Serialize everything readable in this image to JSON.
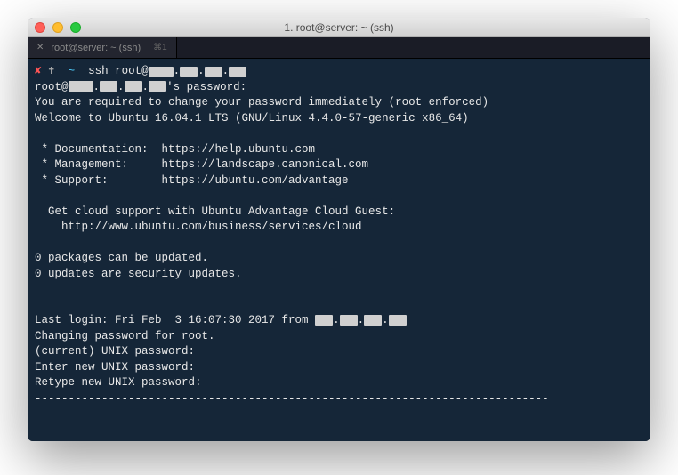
{
  "window": {
    "title": "1. root@server: ~ (ssh)"
  },
  "tab": {
    "label": "root@server: ~ (ssh)",
    "shortcut": "⌘1"
  },
  "prompt": {
    "x": "✘",
    "cross": "✝",
    "tilde": "~",
    "command": "ssh root@"
  },
  "lines": {
    "l1a": "root@",
    "l1b": "'s password:",
    "l2": "You are required to change your password immediately (root enforced)",
    "l3": "Welcome to Ubuntu 16.04.1 LTS (GNU/Linux 4.4.0-57-generic x86_64)",
    "l4": " * Documentation:  https://help.ubuntu.com",
    "l5": " * Management:     https://landscape.canonical.com",
    "l6": " * Support:        https://ubuntu.com/advantage",
    "l7": "  Get cloud support with Ubuntu Advantage Cloud Guest:",
    "l8": "    http://www.ubuntu.com/business/services/cloud",
    "l9": "0 packages can be updated.",
    "l10": "0 updates are security updates.",
    "l11a": "Last login: Fri Feb  3 16:07:30 2017 from ",
    "l12": "Changing password for root.",
    "l13": "(current) UNIX password:",
    "l14": "Enter new UNIX password:",
    "l15": "Retype new UNIX password:",
    "divider": "-----------------------------------------------------------------------------"
  }
}
